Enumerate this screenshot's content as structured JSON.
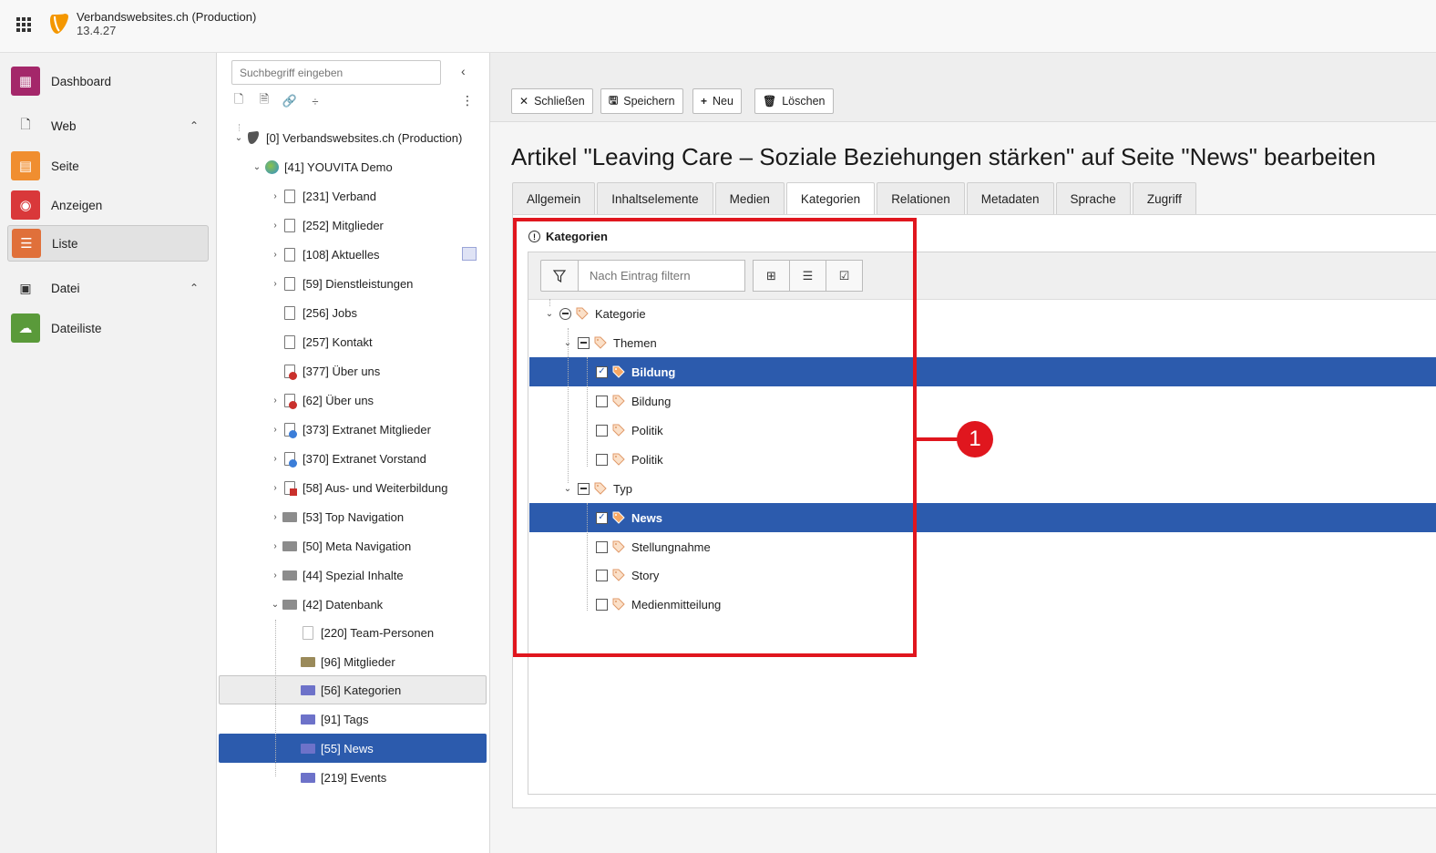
{
  "topbar": {
    "site_title": "Verbandswebsites.ch (Production)",
    "version": "13.4.27"
  },
  "modules": {
    "dashboard": "Dashboard",
    "web_group": "Web",
    "seite": "Seite",
    "anzeigen": "Anzeigen",
    "liste": "Liste",
    "datei_group": "Datei",
    "dateiliste": "Dateiliste"
  },
  "pagetree": {
    "search_placeholder": "Suchbegriff eingeben",
    "nodes": [
      "[0] Verbandswebsites.ch (Production)",
      "[41] YOUVITA Demo",
      "[231] Verband",
      "[252] Mitglieder",
      "[108] Aktuelles",
      "[59] Dienstleistungen",
      "[256] Jobs",
      "[257] Kontakt",
      "[377] Über uns",
      "[62] Über uns",
      "[373] Extranet Mitglieder",
      "[370] Extranet Vorstand",
      "[58] Aus- und Weiterbildung",
      "[53] Top Navigation",
      "[50] Meta Navigation",
      "[44] Spezial Inhalte",
      "[42] Datenbank",
      "[220] Team-Personen",
      "[96] Mitglieder",
      "[56] Kategorien",
      "[91] Tags",
      "[55] News",
      "[219] Events"
    ]
  },
  "buttons": {
    "close": "Schließen",
    "save": "Speichern",
    "new": "Neu",
    "delete": "Löschen"
  },
  "heading": "Artikel \"Leaving Care – Soziale Beziehungen stärken\" auf Seite \"News\" bearbeiten",
  "tabs": [
    "Allgemein",
    "Inhaltselemente",
    "Medien",
    "Kategorien",
    "Relationen",
    "Metadaten",
    "Sprache",
    "Zugriff"
  ],
  "categories": {
    "label": "Kategorien",
    "filter_placeholder": "Nach Eintrag filtern",
    "root": "Kategorie",
    "themen": "Themen",
    "themen_items": [
      "Bildung",
      "Bildung",
      "Politik",
      "Politik"
    ],
    "typ": "Typ",
    "typ_items": [
      "News",
      "Stellungnahme",
      "Story",
      "Medienmitteilung"
    ]
  },
  "annotation": {
    "badge": "1"
  },
  "colors": {
    "selected": "#2c5bad",
    "annotation": "#e0161e"
  }
}
